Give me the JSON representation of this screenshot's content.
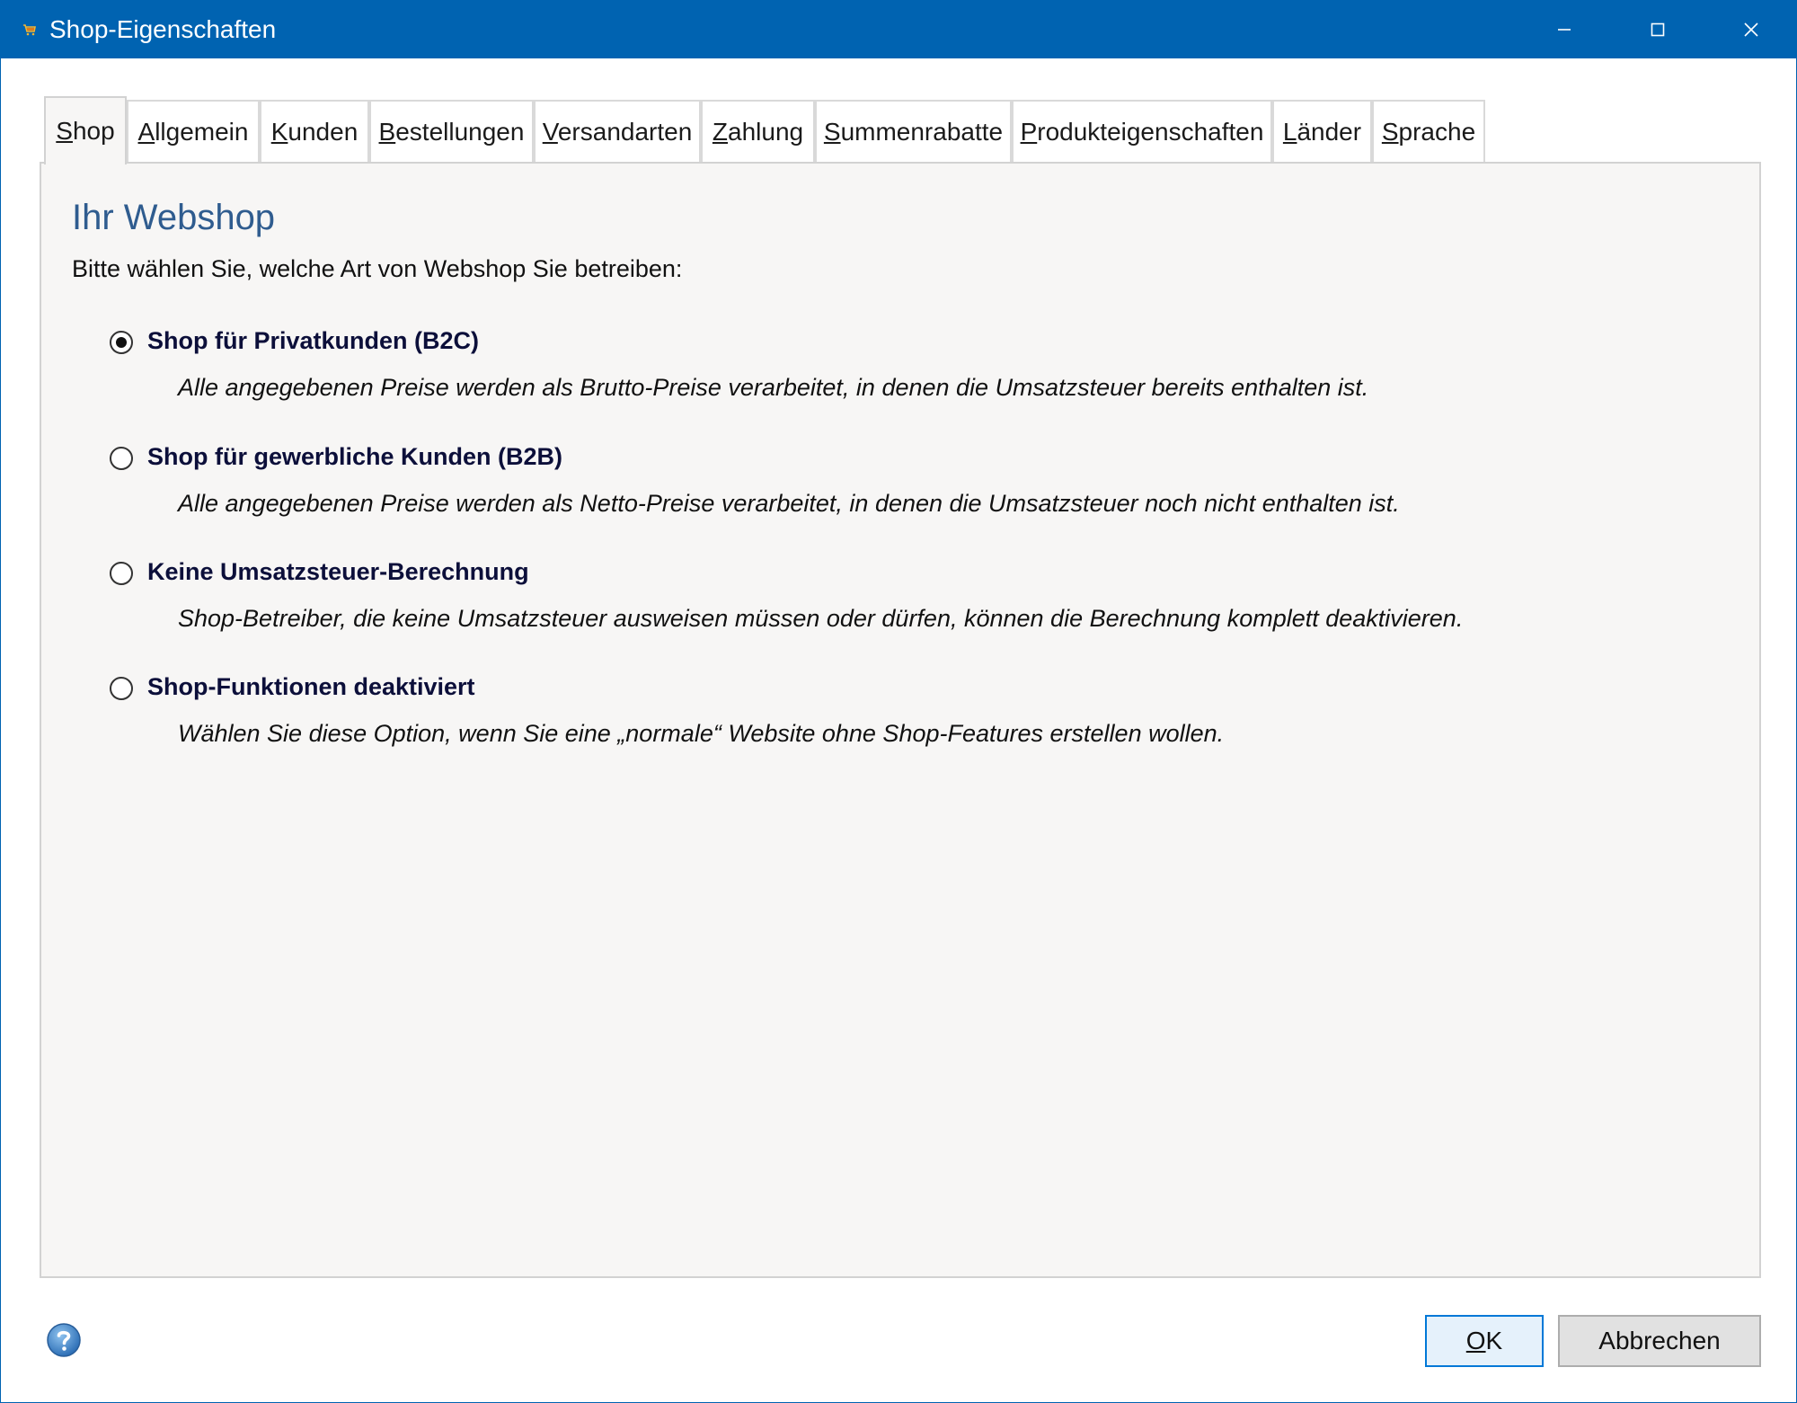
{
  "window": {
    "title": "Shop-Eigenschaften",
    "icon": "shop-cart-icon",
    "title_bar_color": "#0063b1",
    "controls": [
      "minimize-icon",
      "maximize-icon",
      "close-icon"
    ]
  },
  "tabs": [
    {
      "mnemonic": "S",
      "rest": "hop",
      "active": true
    },
    {
      "mnemonic": "A",
      "rest": "llgemein"
    },
    {
      "mnemonic": "K",
      "rest": "unden"
    },
    {
      "mnemonic": "B",
      "rest": "estellungen"
    },
    {
      "mnemonic": "V",
      "rest": "ersandarten"
    },
    {
      "mnemonic": "Z",
      "rest": "ahlung"
    },
    {
      "mnemonic": "S",
      "rest": "ummenrabatte"
    },
    {
      "mnemonic": "P",
      "rest": "rodukteigenschaften"
    },
    {
      "mnemonic": "L",
      "rest": "änder"
    },
    {
      "mnemonic": "S",
      "rest": "prache"
    }
  ],
  "main": {
    "heading": "Ihr Webshop",
    "intro": "Bitte wählen Sie, welche Art von Webshop Sie betreiben:",
    "options": [
      {
        "label": "Shop für Privatkunden (B2C)",
        "description": "Alle angegebenen Preise werden als Brutto-Preise verarbeitet, in denen die Umsatzsteuer bereits enthalten ist.",
        "checked": true
      },
      {
        "label": "Shop für gewerbliche Kunden (B2B)",
        "description": "Alle angegebenen Preise werden als Netto-Preise verarbeitet, in denen die Umsatzsteuer noch nicht enthalten ist.",
        "checked": false
      },
      {
        "label": "Keine Umsatzsteuer-Berechnung",
        "description": "Shop-Betreiber, die keine Umsatzsteuer ausweisen müssen oder dürfen, können die Berechnung komplett deaktivieren.",
        "checked": false
      },
      {
        "label": "Shop-Funktionen deaktiviert",
        "description": "Wählen Sie diese Option, wenn Sie eine „normale“ Website ohne Shop-Features erstellen wollen.",
        "checked": false
      }
    ]
  },
  "footer": {
    "help_icon": "help-icon",
    "ok": {
      "mnemonic": "O",
      "rest": "K"
    },
    "cancel_label": "Abbrechen"
  }
}
